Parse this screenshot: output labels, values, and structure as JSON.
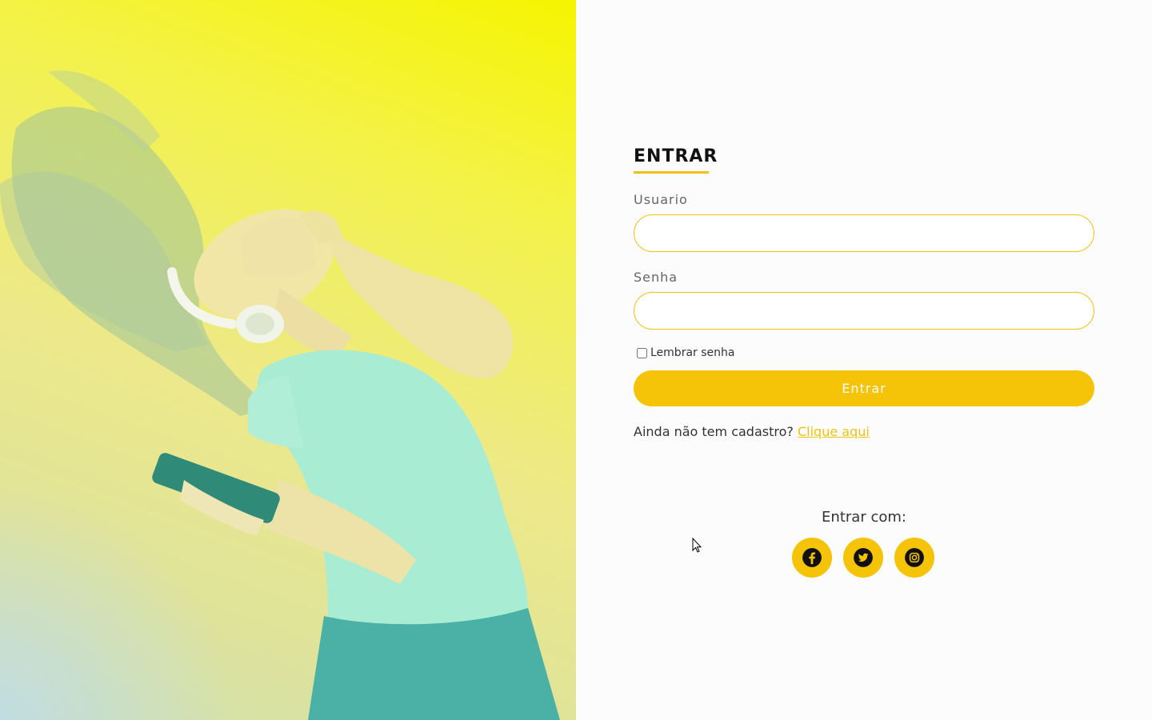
{
  "hero": {
    "image": "woman-with-headphones-dancing"
  },
  "login": {
    "title": "ENTRAR",
    "username_label": "Usuario",
    "username_value": "",
    "password_label": "Senha",
    "password_value": "",
    "remember_label": "Lembrar senha",
    "remember_checked": false,
    "submit_label": "Entrar",
    "signup_prompt": "Ainda não tem cadastro?",
    "signup_link": "Clique aqui"
  },
  "social": {
    "label": "Entrar com:",
    "icons": [
      "facebook-icon",
      "twitter-icon",
      "instagram-icon"
    ]
  },
  "colors": {
    "accent": "#f5c307",
    "hero_top": "#f6f400",
    "text": "#333333"
  }
}
